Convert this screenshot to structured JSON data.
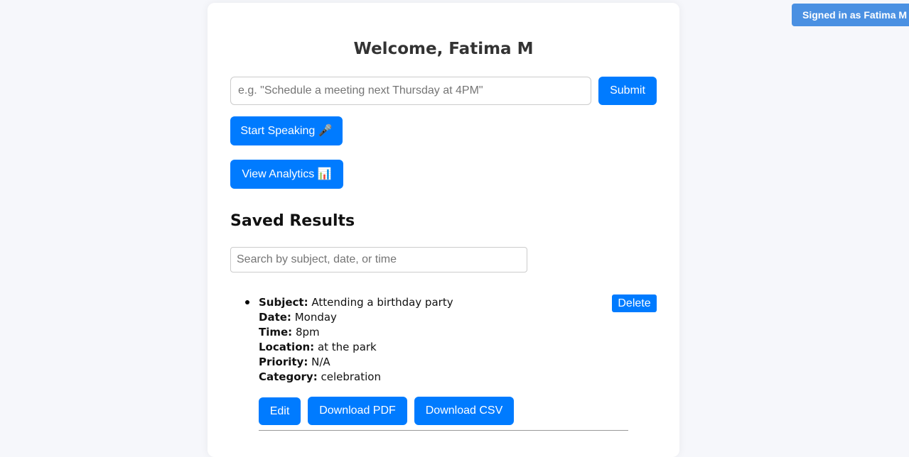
{
  "header": {
    "signed_in_label": "Signed in as Fatima M"
  },
  "main": {
    "welcome_title": "Welcome, Fatima M",
    "command_input": {
      "placeholder": "e.g. \"Schedule a meeting next Thursday at 4PM\"",
      "value": ""
    },
    "submit_label": "Submit",
    "speak_label": "Start Speaking 🎤",
    "analytics_label": "View Analytics 📊"
  },
  "saved_results": {
    "title": "Saved Results",
    "search_placeholder": "Search by subject, date, or time",
    "items": [
      {
        "subject_label": "Subject:",
        "subject": "Attending a birthday party",
        "date_label": "Date:",
        "date": "Monday",
        "time_label": "Time:",
        "time": "8pm",
        "location_label": "Location:",
        "location": "at the park",
        "priority_label": "Priority:",
        "priority": "N/A",
        "category_label": "Category:",
        "category": "celebration",
        "delete_label": "Delete",
        "edit_label": "Edit",
        "download_pdf_label": "Download PDF",
        "download_csv_label": "Download CSV"
      }
    ]
  },
  "colors": {
    "primary": "#007bff",
    "badge": "#4a90e2",
    "background": "#f6f7fb"
  }
}
